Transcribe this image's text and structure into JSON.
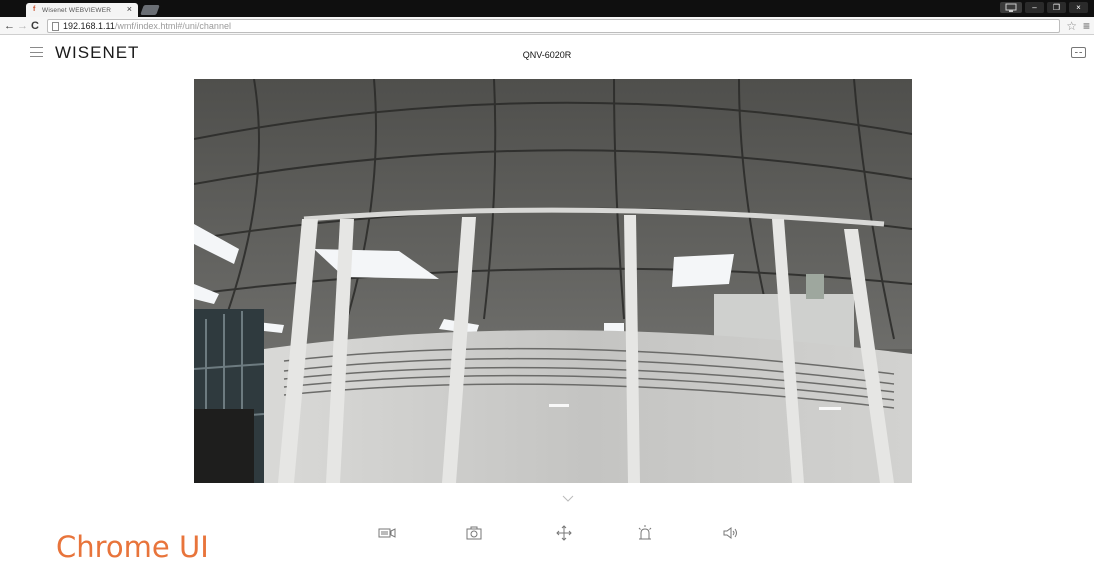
{
  "browser": {
    "tab": {
      "title": "Wisenet WEBVIEWER",
      "favicon": "wisenet-favicon",
      "close": "×"
    },
    "nav": {
      "back": "←",
      "forward": "→",
      "reload": "C"
    },
    "address": {
      "host": "192.168.1.11",
      "path": "/wmf/index.html#/uni/channel"
    },
    "star": "☆",
    "menu": "≡",
    "window_controls": {
      "minimize": "–",
      "restore": "❐",
      "close": "×"
    }
  },
  "app": {
    "logo": "WISENET",
    "model": "QNV-6020R"
  },
  "controls": [
    {
      "name": "record-icon"
    },
    {
      "name": "snapshot-icon"
    },
    {
      "name": "ptz-icon"
    },
    {
      "name": "alarm-output-icon"
    },
    {
      "name": "audio-icon"
    }
  ],
  "overlay": {
    "label": "Chrome UI"
  },
  "colors": {
    "overlay_label": "#e8743b",
    "tabstrip": "#0f0f0f"
  }
}
